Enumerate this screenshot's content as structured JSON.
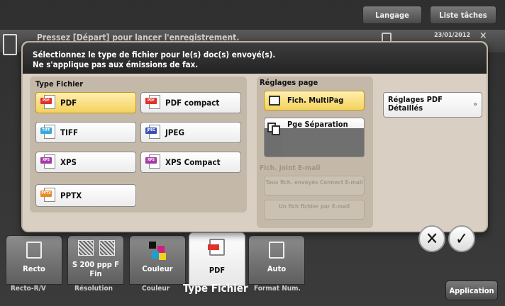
{
  "top_bar": {
    "language": "Langage",
    "jobs": "Liste tâches"
  },
  "status": {
    "text": "Pressez [Départ] pour lancer l'enregistrement.",
    "date": "23/01/2012"
  },
  "dialog": {
    "header_line1": "Sélectionnez le type de fichier pour le(s) doc(s) envoyé(s).",
    "header_line2": "Ne s'applique pas aux émissions de fax.",
    "file_type": {
      "title": "Type Fichier",
      "options": [
        {
          "label": "PDF",
          "tag": "PDF",
          "tag_color": "#e0322a",
          "selected": true
        },
        {
          "label": "PDF compact",
          "tag": "PDF",
          "tag_color": "#e0322a",
          "selected": false
        },
        {
          "label": "TIFF",
          "tag": "TIFF",
          "tag_color": "#3ba7d8",
          "selected": false
        },
        {
          "label": "JPEG",
          "tag": "JPEG",
          "tag_color": "#3b4fb8",
          "selected": false
        },
        {
          "label": "XPS",
          "tag": "XPS",
          "tag_color": "#a43aa8",
          "selected": false
        },
        {
          "label": "XPS Compact",
          "tag": "XPS",
          "tag_color": "#a43aa8",
          "selected": false
        },
        {
          "label": "PPTX",
          "tag": "PPTX",
          "tag_color": "#e98a22",
          "selected": false
        }
      ]
    },
    "page_settings": {
      "title": "Réglages page",
      "multipage": "Fich. MultiPag",
      "separation": "Pge Séparation",
      "email_title": "Fich. Joint E-mail",
      "email_all": "Tous fich. envoyés Connect E-mail",
      "email_one": "Un fich fichier par E-mail"
    },
    "pdf_settings": {
      "line1": "Réglages PDF",
      "line2": "Détaillés",
      "arrow": "»"
    }
  },
  "buttons": {
    "cancel": "✕",
    "ok": "✓",
    "application": "Application"
  },
  "tabs": {
    "recto": "Recto",
    "resolution": "S 200 ppp F Fin",
    "couleur": "Couleur",
    "pdf": "PDF",
    "auto": "Auto"
  },
  "tab_labels": {
    "recto": "Recto-R/V",
    "resolution": "Résolution",
    "couleur": "Couleur",
    "type_fichier": "Type Fichier",
    "format": "Format Num."
  }
}
